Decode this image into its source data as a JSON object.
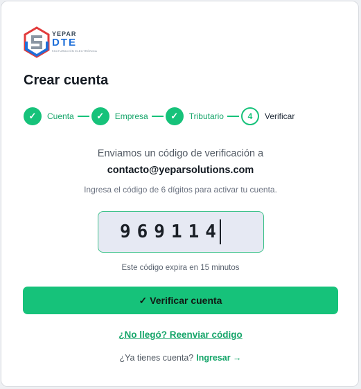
{
  "logo": {
    "brand": "YEPAR",
    "product": "DTE",
    "tagline": "FACTURACIÓN ELECTRÓNICA"
  },
  "page": {
    "title": "Crear cuenta"
  },
  "steps": [
    {
      "number": "✓",
      "label": "Cuenta",
      "status": "done"
    },
    {
      "number": "✓",
      "label": "Empresa",
      "status": "done"
    },
    {
      "number": "✓",
      "label": "Tributario",
      "status": "done"
    },
    {
      "number": "4",
      "label": "Verificar",
      "status": "current"
    }
  ],
  "verification": {
    "sent_text": "Enviamos un código de verificación a",
    "email": "contacto@yeparsolutions.com",
    "instructions": "Ingresa el código de 6 dígitos para activar tu cuenta.",
    "code_value": "969114",
    "expiry_text": "Este código expira en 15 minutos",
    "verify_button": "✓ Verificar cuenta",
    "resend_link": "¿No llegó? Reenviar código",
    "login_prompt": "¿Ya tienes cuenta?",
    "login_link": "Ingresar →"
  },
  "colors": {
    "accent": "#16c27a",
    "accent_text": "#16a56a",
    "code_bg": "#e6e9f3"
  }
}
